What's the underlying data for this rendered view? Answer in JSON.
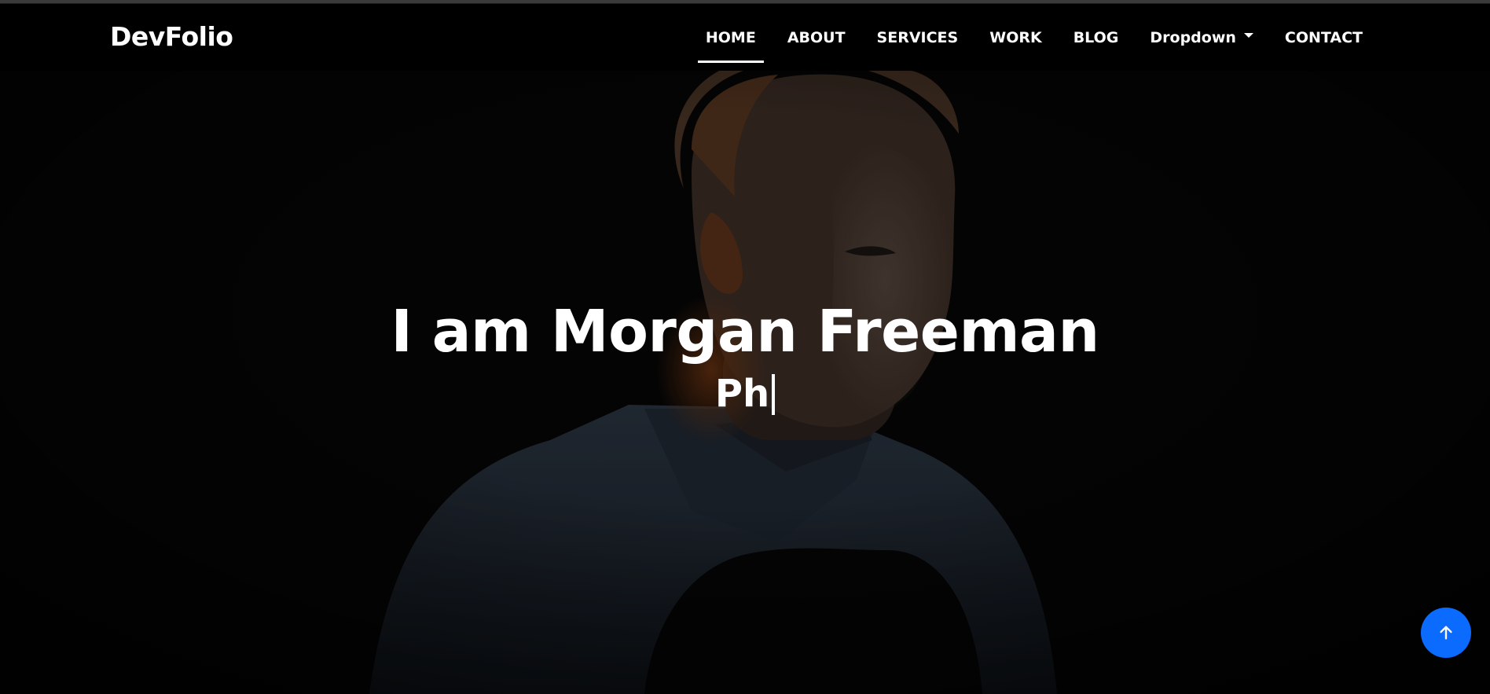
{
  "brand": {
    "name": "DevFolio"
  },
  "nav": {
    "items": [
      {
        "label": "HOME",
        "active": true
      },
      {
        "label": "ABOUT",
        "active": false
      },
      {
        "label": "SERVICES",
        "active": false
      },
      {
        "label": "WORK",
        "active": false
      },
      {
        "label": "BLOG",
        "active": false
      },
      {
        "label": "Dropdown",
        "active": false,
        "dropdown": true
      },
      {
        "label": "CONTACT",
        "active": false
      }
    ]
  },
  "hero": {
    "title": "I am Morgan Freeman",
    "typed_text": "Ph"
  },
  "back_to_top": {
    "icon": "arrow-up-icon"
  },
  "colors": {
    "accent": "#0c6bff",
    "navbar_bg": "#000000",
    "text": "#ffffff"
  }
}
